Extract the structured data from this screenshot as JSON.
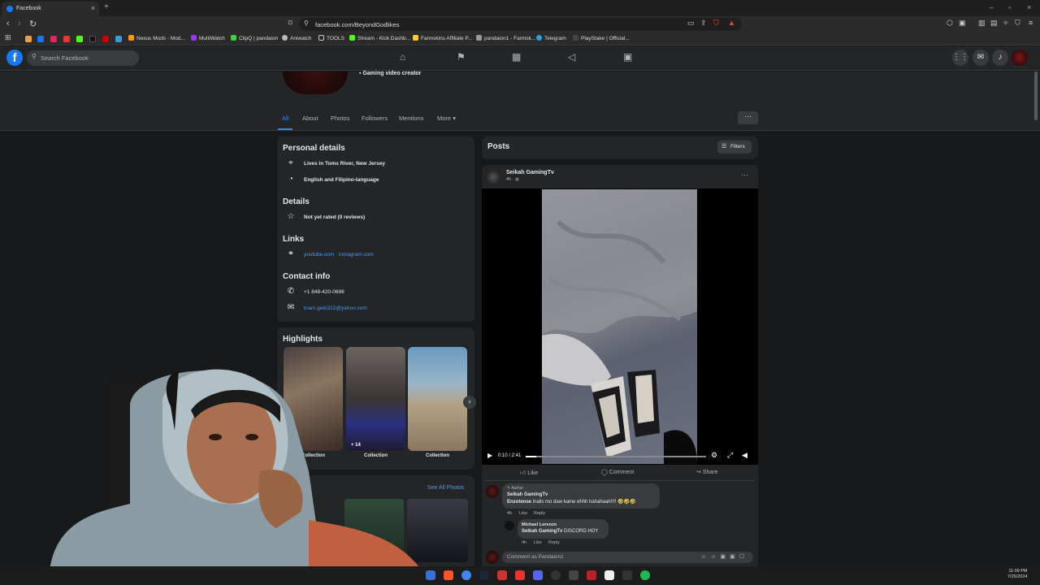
{
  "browser": {
    "tab_title": "Facebook",
    "url": "facebook.com/BeyondGodlikes",
    "bookmarks": [
      "Nexus Mods - Mod...",
      "MultiWatch",
      "ClipQ | pandaion",
      "Aniwatch",
      "TOOLS",
      "Stream - Kick Dashb...",
      "Farmskins Affiliate P...",
      "pandaion1 - Farmsk...",
      "Telegram",
      "PlayStake | Official..."
    ]
  },
  "header": {
    "search_placeholder": "Search Facebook"
  },
  "profile": {
    "creator_label": "Gaming video creator",
    "tabs": [
      "All",
      "About",
      "Photos",
      "Followers",
      "Mentions",
      "More"
    ],
    "more_button": "···"
  },
  "personal": {
    "title": "Personal details",
    "location": "Lives in Toms River, New Jersey",
    "languages": "English and Filipino-language"
  },
  "details": {
    "title": "Details",
    "rating": "Not yet rated (0 reviews)"
  },
  "links": {
    "title": "Links",
    "value": "youtube.com · instagram.com"
  },
  "contact": {
    "title": "Contact info",
    "phone": "+1 848-420-0698",
    "email": "kram.gelo322@yahoo.com"
  },
  "highlights": {
    "title": "Highlights",
    "items": [
      {
        "label": "Collection",
        "badge": ""
      },
      {
        "label": "Collection",
        "badge": "+ 14"
      },
      {
        "label": "Collection",
        "badge": ""
      }
    ],
    "see_all": "See All Photos"
  },
  "posts": {
    "title": "Posts",
    "filters": "Filters",
    "author": "Seikah GamingTv",
    "time": "4h · ",
    "video_time": "0:10 / 2:41",
    "progress": 0.06,
    "actions": {
      "like": "Like",
      "comment": "Comment",
      "share": "Share"
    },
    "comments": [
      {
        "badge": "Author",
        "name": "Seikah GamingTv",
        "tagged": "Enzotense",
        "text": " inalis mo daw kame ehhh hahahaah!!!! 🤣🤣🤣",
        "time": "4h",
        "like": "Like",
        "reply": "Reply"
      },
      {
        "name": "Michael Lorenzo",
        "tagged": "Seikah GamingTv",
        "text": " DISCORD HOY",
        "time": "4h",
        "like": "Like",
        "reply": "Reply"
      }
    ],
    "comment_placeholder": "Comment as Pandaion1"
  },
  "taskbar": {
    "time": "11:09 PM",
    "date": "7/26/2024"
  },
  "colors": {
    "accent": "#2d88ff",
    "fb_blue": "#1877f2",
    "bg": "#18191a",
    "card": "#242526"
  }
}
